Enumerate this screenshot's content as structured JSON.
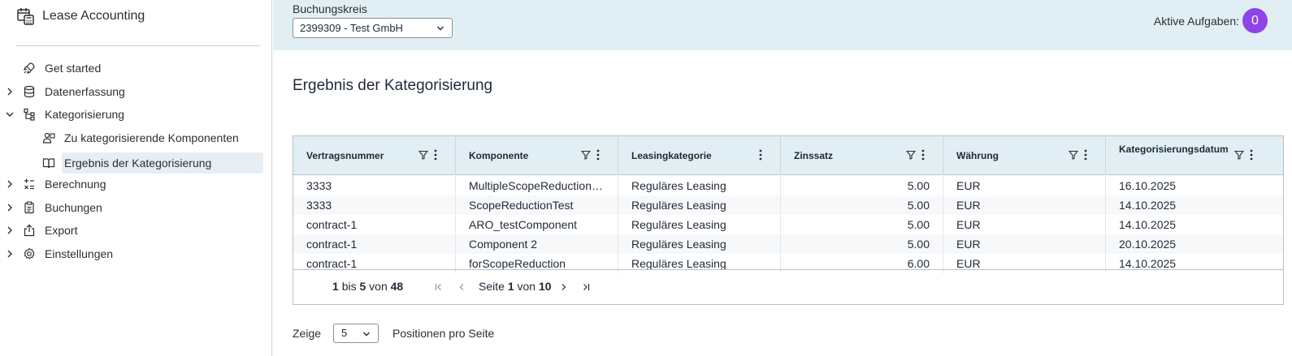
{
  "app": {
    "title": "Lease Accounting"
  },
  "sidebar": {
    "items": [
      {
        "label": "Get started",
        "icon": "rocket-icon"
      },
      {
        "label": "Datenerfassung",
        "icon": "database-icon",
        "chevron": "chevron-right-icon"
      },
      {
        "label": "Kategorisierung",
        "icon": "hierarchy-icon",
        "chevron": "chevron-down-icon"
      },
      {
        "label": "Zu kategorisierende Komponenten",
        "icon": "people-icon"
      },
      {
        "label": "Ergebnis der Kategorisierung",
        "icon": "book-icon",
        "active": true
      },
      {
        "label": "Berechnung",
        "icon": "calculator-icon",
        "chevron": "chevron-right-icon"
      },
      {
        "label": "Buchungen",
        "icon": "clipboard-icon",
        "chevron": "chevron-right-icon"
      },
      {
        "label": "Export",
        "icon": "export-icon",
        "chevron": "chevron-right-icon"
      },
      {
        "label": "Einstellungen",
        "icon": "gear-icon",
        "chevron": "chevron-right-icon"
      }
    ]
  },
  "header": {
    "buchungskreis_label": "Buchungskreis",
    "buchungskreis_value": "2399309 - Test GmbH",
    "tasks_label": "Aktive Aufgaben:",
    "tasks_count": "0",
    "badge_color": "#8e44e8"
  },
  "main": {
    "title": "Ergebnis der Kategorisierung",
    "table": {
      "columns": [
        {
          "label": "Vertragsnummer",
          "filter": true
        },
        {
          "label": "Komponente",
          "filter": true
        },
        {
          "label": "Leasingkategorie",
          "filter": false
        },
        {
          "label": "Zinssatz",
          "filter": true
        },
        {
          "label": "Währung",
          "filter": true
        },
        {
          "label": "Kategorisierungsdatum",
          "filter": true
        }
      ],
      "rows": [
        [
          "3333",
          "MultipleScopeReductionTest",
          "Reguläres Leasing",
          "5.00",
          "EUR",
          "16.10.2025"
        ],
        [
          "3333",
          "ScopeReductionTest",
          "Reguläres Leasing",
          "5.00",
          "EUR",
          "14.10.2025"
        ],
        [
          "contract-1",
          "ARO_testComponent",
          "Reguläres Leasing",
          "5.00",
          "EUR",
          "14.10.2025"
        ],
        [
          "contract-1",
          "Component 2",
          "Reguläres Leasing",
          "5.00",
          "EUR",
          "20.10.2025"
        ],
        [
          "contract-1",
          "forScopeReduction",
          "Reguläres Leasing",
          "6.00",
          "EUR",
          "14.10.2025"
        ]
      ]
    },
    "pager": {
      "from": "1",
      "bis": "bis",
      "to": "5",
      "von": "von",
      "total": "48",
      "seite": "Seite",
      "page": "1",
      "von2": "von",
      "pages": "10"
    },
    "page_size": {
      "label_before": "Zeige",
      "value": "5",
      "label_after": "Positionen pro Seite"
    }
  }
}
